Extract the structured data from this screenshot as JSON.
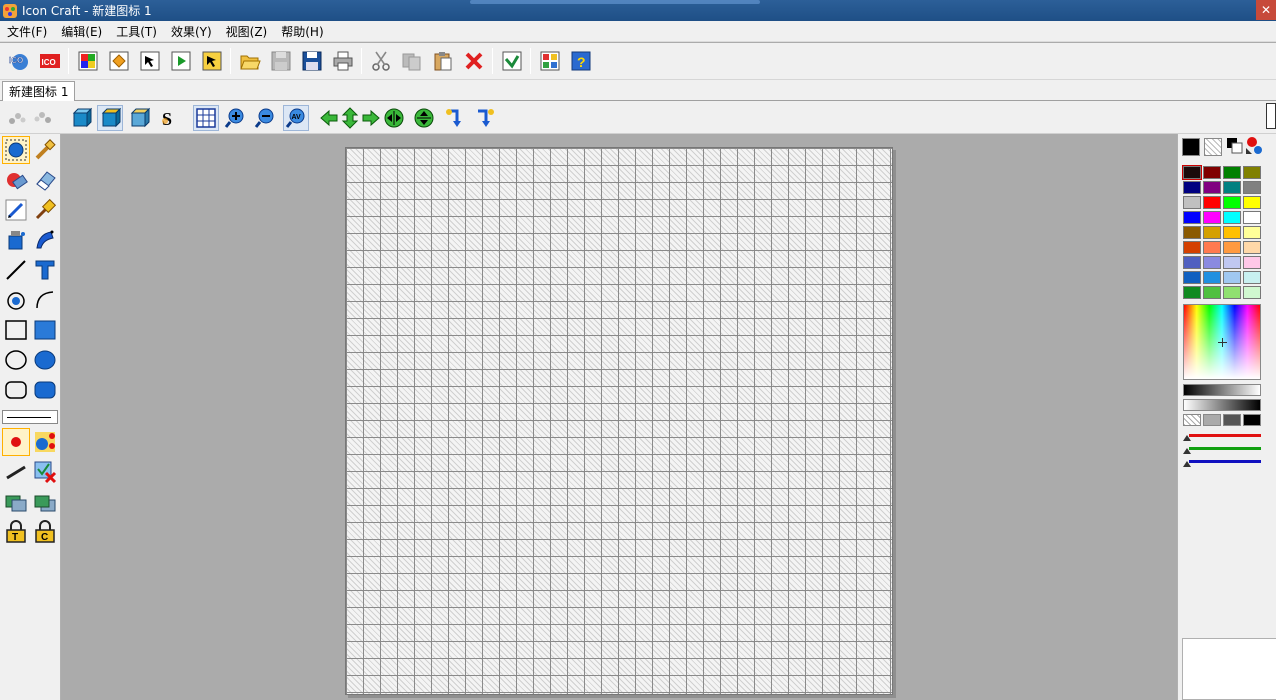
{
  "window": {
    "title": "Icon Craft - 新建图标 1",
    "close_label": "✕"
  },
  "menu": [
    "文件(F)",
    "编辑(E)",
    "工具(T)",
    "效果(Y)",
    "视图(Z)",
    "帮助(H)"
  ],
  "toolbar": {
    "ico_label": "ICO",
    "buttons": [
      "new-icon",
      "ico",
      "color-image",
      "edit-diamond",
      "cursor",
      "animated-cursor",
      "cursor-frame",
      "open-folder",
      "save-disabled",
      "save",
      "print",
      "cut",
      "copy-disabled",
      "paste",
      "delete",
      "check",
      "resources",
      "help"
    ]
  },
  "document_tab": "新建图标 1",
  "colors": {
    "titlebar": "#1e4f86",
    "panel": "#f0f0f0",
    "workspace": "#ababab",
    "primary_color": "#000000",
    "secondary_color": "#ffffff"
  },
  "palette": {
    "swatches": [
      "#1a0a0a",
      "#800000",
      "#008000",
      "#808000",
      "#000080",
      "#800080",
      "#008080",
      "#808080",
      "#c0c0c0",
      "#ff0000",
      "#00ff00",
      "#ffff00",
      "#0000ff",
      "#ff00ff",
      "#00ffff",
      "#ffffff",
      "#8b5a00",
      "#d4a000",
      "#ffc000",
      "#ffff99",
      "#d44000",
      "#ff7a50",
      "#ff9a40",
      "#ffd8a8",
      "#5060c0",
      "#8a8ae0",
      "#c0c8f0",
      "#ffc8e8",
      "#1060c0",
      "#2090e0",
      "#a0c8f0",
      "#c8f0f0",
      "#108a20",
      "#50c040",
      "#90e070",
      "#d0f8d0"
    ],
    "selected_index": 0
  }
}
